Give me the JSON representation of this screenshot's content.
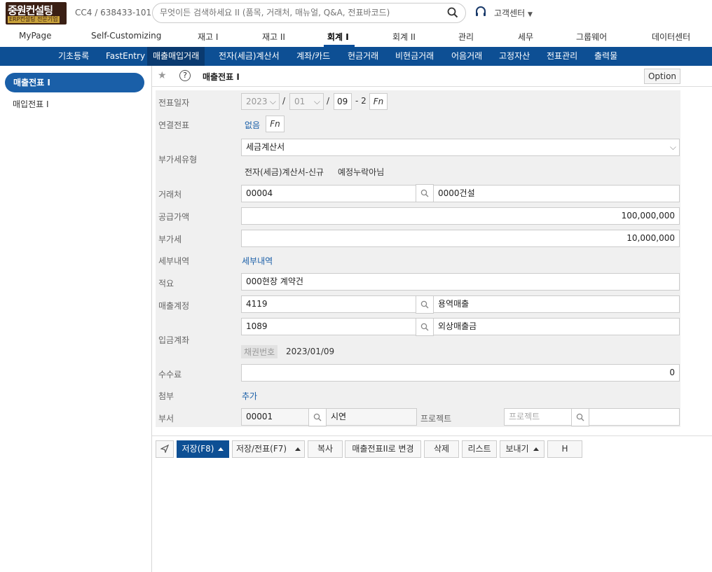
{
  "header": {
    "logo_main": "중원컨설팅",
    "logo_sub": "ERP컨설팅 전문기업",
    "company": "CC4 / 638433-101",
    "search_placeholder": "무엇이든 검색하세요 II (품목, 거래처, 매뉴얼, Q&A, 전표바코드)",
    "help_label": "고객센터"
  },
  "main_menu": [
    "MyPage",
    "Self-Customizing",
    "재고 I",
    "재고 II",
    "회계 I",
    "회계 II",
    "관리",
    "세무",
    "그룹웨어",
    "데이터센터"
  ],
  "sub_menu": [
    "기초등록",
    "FastEntry",
    "매출매입거래",
    "전자(세금)계산서",
    "계좌/카드",
    "현금거래",
    "비현금거래",
    "어음거래",
    "고정자산",
    "전표관리",
    "출력물"
  ],
  "left_panel": {
    "items": [
      "매출전표 I",
      "매입전표 I"
    ]
  },
  "content": {
    "title": "매출전표 I",
    "option_label": "Option"
  },
  "form": {
    "date_label": "전표일자",
    "year": "2023",
    "month": "01",
    "day": "09",
    "date_suffix": "- 2",
    "fn": "Fn",
    "linked_label": "연결전표",
    "linked_value": "없음",
    "vat_type_label": "부가세유형",
    "vat_type_value": "세금계산서",
    "vat_tag1": "전자(세금)계산서-신규",
    "vat_tag2": "예정누락아님",
    "customer_label": "거래처",
    "customer_code": "00004",
    "customer_name": "0000건설",
    "supply_label": "공급가액",
    "supply_value": "100,000,000",
    "vat_label": "부가세",
    "vat_value": "10,000,000",
    "detail_label": "세부내역",
    "detail_link": "세부내역",
    "summary_label": "적요",
    "summary_value": "000현장 계약건",
    "sales_acct_label": "매출계정",
    "sales_acct_code": "4119",
    "sales_acct_name": "용역매출",
    "deposit_label": "입금계좌",
    "deposit_code": "1089",
    "deposit_name": "외상매출금",
    "bond_tag": "채권번호",
    "bond_date": "2023/01/09",
    "fee_label": "수수료",
    "fee_value": "0",
    "attach_label": "첨부",
    "attach_link": "추가",
    "dept_label": "부서",
    "dept_code": "00001",
    "dept_name": "시연",
    "project_label": "프로젝트",
    "project_placeholder": "프로젝트"
  },
  "toolbar": {
    "save": "저장(F8)",
    "save_slip": "저장/전표(F7)",
    "copy": "복사",
    "change": "매출전표II로 변경",
    "delete": "삭제",
    "list": "리스트",
    "send": "보내기",
    "h": "H"
  },
  "colors": {
    "primary": "#0d4f94",
    "submenu_active": "#0a3a70",
    "form_bg": "#f0f0f0"
  }
}
